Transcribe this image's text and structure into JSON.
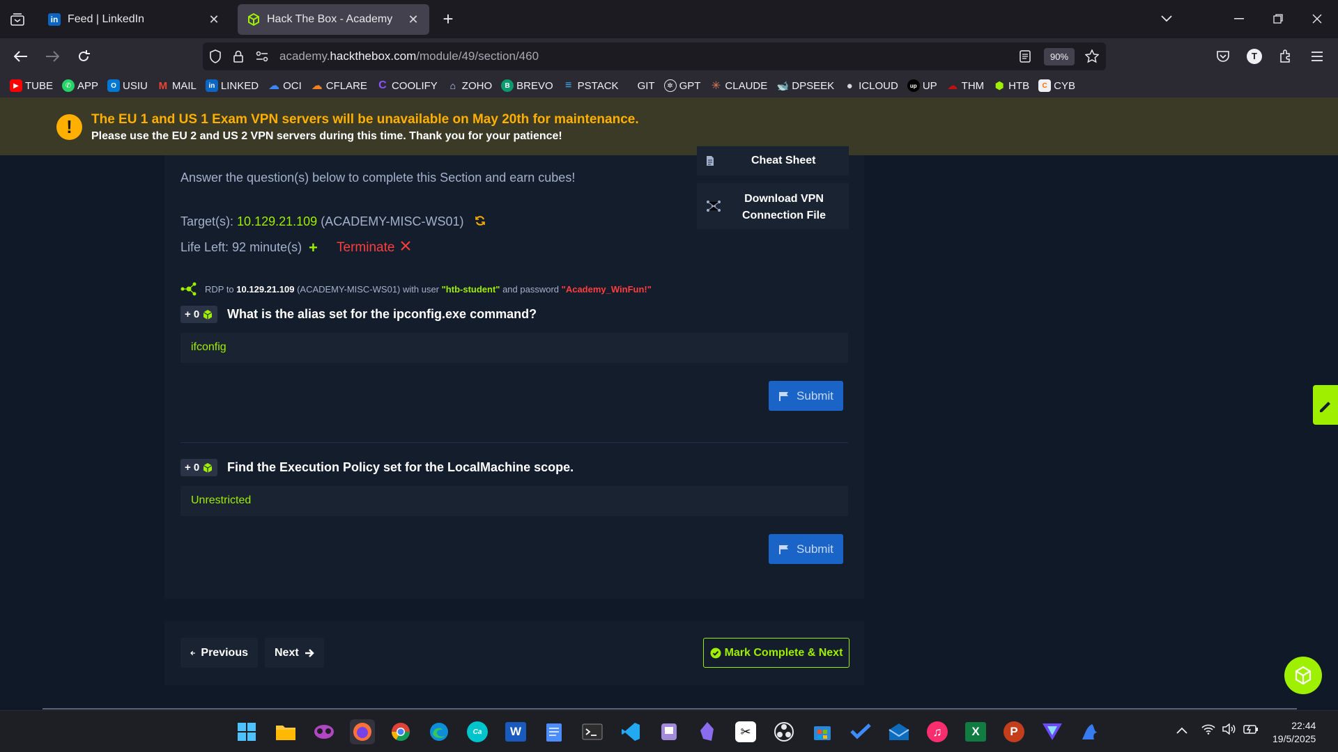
{
  "browser": {
    "tabs": [
      {
        "title": "Feed | LinkedIn",
        "active": false
      },
      {
        "title": "Hack The Box - Academy",
        "active": true
      }
    ],
    "url_prefix": "academy.",
    "url_domain": "hackthebox.com",
    "url_path": "/module/49/section/460",
    "zoom": "90%",
    "profile_initial": "T",
    "bookmarks": [
      "TUBE",
      "APP",
      "USIU",
      "MAIL",
      "LINKED",
      "OCI",
      "CFLARE",
      "COOLIFY",
      "ZOHO",
      "BREVO",
      "PSTACK",
      "GIT",
      "GPT",
      "CLAUDE",
      "DPSEEK",
      "ICLOUD",
      "UP",
      "THM",
      "HTB",
      "CYB"
    ]
  },
  "banner": {
    "title": "The EU 1 and US 1 Exam VPN servers will be unavailable on May 20th for maintenance.",
    "message": "Please use the EU 2 and US 2 VPN servers during this time. Thank you for your patience!",
    "icon": "!"
  },
  "sidebar_cards": {
    "cheat_sheet": "Cheat Sheet",
    "vpn_line1": "Download VPN",
    "vpn_line2": "Connection File"
  },
  "questions_section": {
    "subtitle": "Answer the question(s) below to complete this Section and earn cubes!",
    "target_label": "Target(s):",
    "target_ip": "10.129.21.109",
    "target_host": "(ACADEMY-MISC-WS01)",
    "life_left": "Life Left: 92 minute(s)",
    "plus": "+",
    "terminate": "Terminate",
    "rdp": {
      "prefix": "RDP to",
      "ip": "10.129.21.109",
      "host": "(ACADEMY-MISC-WS01) with user",
      "user": "\"htb-student\"",
      "mid": "and password",
      "password": "\"Academy_WinFun!\""
    },
    "questions": [
      {
        "badge": "+ 0",
        "text": "What is the alias set for the ipconfig.exe command?",
        "answer": "ifconfig",
        "submit": "Submit"
      },
      {
        "badge": "+ 0",
        "text": "Find the Execution Policy set for the LocalMachine scope.",
        "answer": "Unrestricted",
        "submit": "Submit"
      }
    ]
  },
  "pagination": {
    "previous": "Previous",
    "next": "Next",
    "mark_complete": "Mark Complete & Next"
  },
  "taskbar": {
    "time": "22:44",
    "date": "19/5/2025"
  },
  "colors": {
    "accent_green": "#9fef00",
    "danger_red": "#ff3e3e",
    "banner_orange": "#ffaf00",
    "submit_blue": "#1a64c8"
  }
}
